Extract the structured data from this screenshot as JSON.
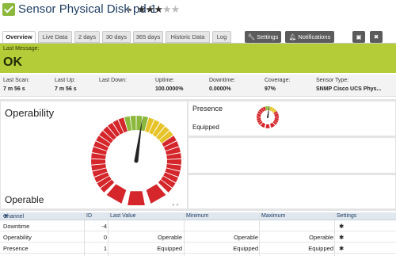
{
  "header": {
    "title": "Sensor Physical Disk pd-1",
    "rating": 3,
    "rating_max": 5,
    "status_color": "#8cb83c"
  },
  "tabs": [
    {
      "label": "Overview",
      "active": true
    },
    {
      "label": "Live Data"
    },
    {
      "label": "2 days"
    },
    {
      "label": "30 days"
    },
    {
      "label": "365 days"
    },
    {
      "label": "Historic Data"
    },
    {
      "label": "Log"
    }
  ],
  "toolbar": {
    "settings_label": "Settings",
    "notifications_label": "Notifications"
  },
  "message": {
    "label": "Last Message:",
    "text": "OK",
    "color": "#b4cc38"
  },
  "stats": [
    {
      "label": "Last Scan:",
      "value": "7 m 56 s"
    },
    {
      "label": "Last Up:",
      "value": "7 m 56 s"
    },
    {
      "label": "Last Down:",
      "value": ""
    },
    {
      "label": "Uptime:",
      "value": "100.0000%"
    },
    {
      "label": "Downtime:",
      "value": "0.0000%"
    },
    {
      "label": "Coverage:",
      "value": "97%"
    },
    {
      "label": "Sensor Type:",
      "value": "SNMP Cisco UCS Phys..."
    }
  ],
  "gauges": {
    "main": {
      "title": "Operability",
      "value": "Operable",
      "level": 0.53
    },
    "presence": {
      "title": "Presence",
      "value": "Equipped",
      "level": 0.53
    }
  },
  "table": {
    "headers": {
      "channel": "Channel",
      "id": "ID",
      "last_value": "Last Value",
      "minimum": "Minimum",
      "maximum": "Maximum",
      "settings": "Settings"
    },
    "rows": [
      {
        "channel": "Downtime",
        "id": "-4",
        "last_value": "",
        "minimum": "",
        "maximum": ""
      },
      {
        "channel": "Operability",
        "id": "0",
        "last_value": "Operable",
        "minimum": "Operable",
        "maximum": "Operable"
      },
      {
        "channel": "Presence",
        "id": "1",
        "last_value": "Equipped",
        "minimum": "Equipped",
        "maximum": "Equipped"
      }
    ]
  }
}
